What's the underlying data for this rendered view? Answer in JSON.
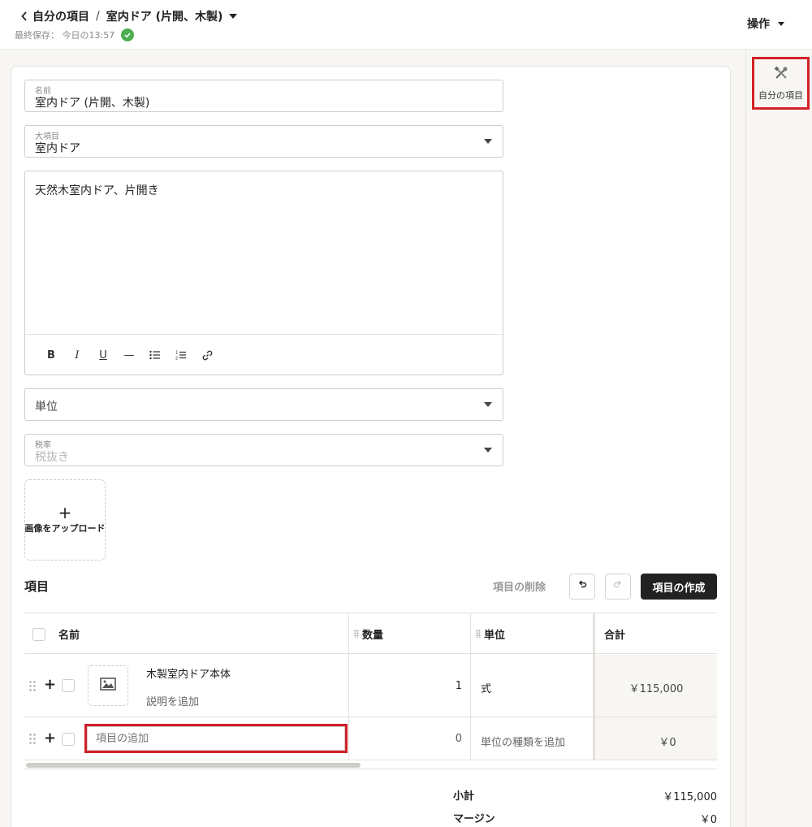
{
  "header": {
    "breadcrumb_parent": "自分の項目",
    "breadcrumb_sep": "/",
    "title": "室内ドア (片開、木製)",
    "last_saved": "最終保存： 今日の13:57",
    "actions_label": "操作"
  },
  "sidebar": {
    "my_items_label": "自分の項目"
  },
  "form": {
    "name_label": "名前",
    "name_value": "室内ドア (片開、木製)",
    "category_label": "大項目",
    "category_value": "室内ドア",
    "description_value": "天然木室内ドア、片開き",
    "unit_placeholder": "単位",
    "tax_label": "税率",
    "tax_placeholder": "税抜き",
    "upload_icon": "+",
    "upload_label": "画像をアップロード"
  },
  "toolbar": {
    "bold": "B",
    "italic": "I",
    "underline": "U",
    "rule": "—",
    "list_icon": "bullet-list-icon",
    "olist_icon": "numbered-list-icon",
    "link_icon": "link-icon"
  },
  "items": {
    "section_title": "項目",
    "delete_label": "項目の削除",
    "create_label": "項目の作成",
    "columns": {
      "name": "名前",
      "qty": "数量",
      "unit": "単位",
      "total": "合計"
    },
    "rows": [
      {
        "name": "木製室内ドア本体",
        "desc_placeholder": "説明を追加",
        "qty": "1",
        "unit": "式",
        "total": "￥115,000"
      }
    ],
    "new_row": {
      "name_placeholder": "項目の追加",
      "qty": "0",
      "unit_placeholder": "単位の種類を追加",
      "total": "￥0"
    }
  },
  "summary": {
    "subtotal_label": "小計",
    "subtotal_value": "￥115,000",
    "margin_label": "マージン",
    "margin_value": "￥0"
  },
  "colors": {
    "highlight": "#d32027",
    "dark_button": "#222222",
    "saved_check": "#4caf50",
    "background": "#f7f6f3"
  }
}
